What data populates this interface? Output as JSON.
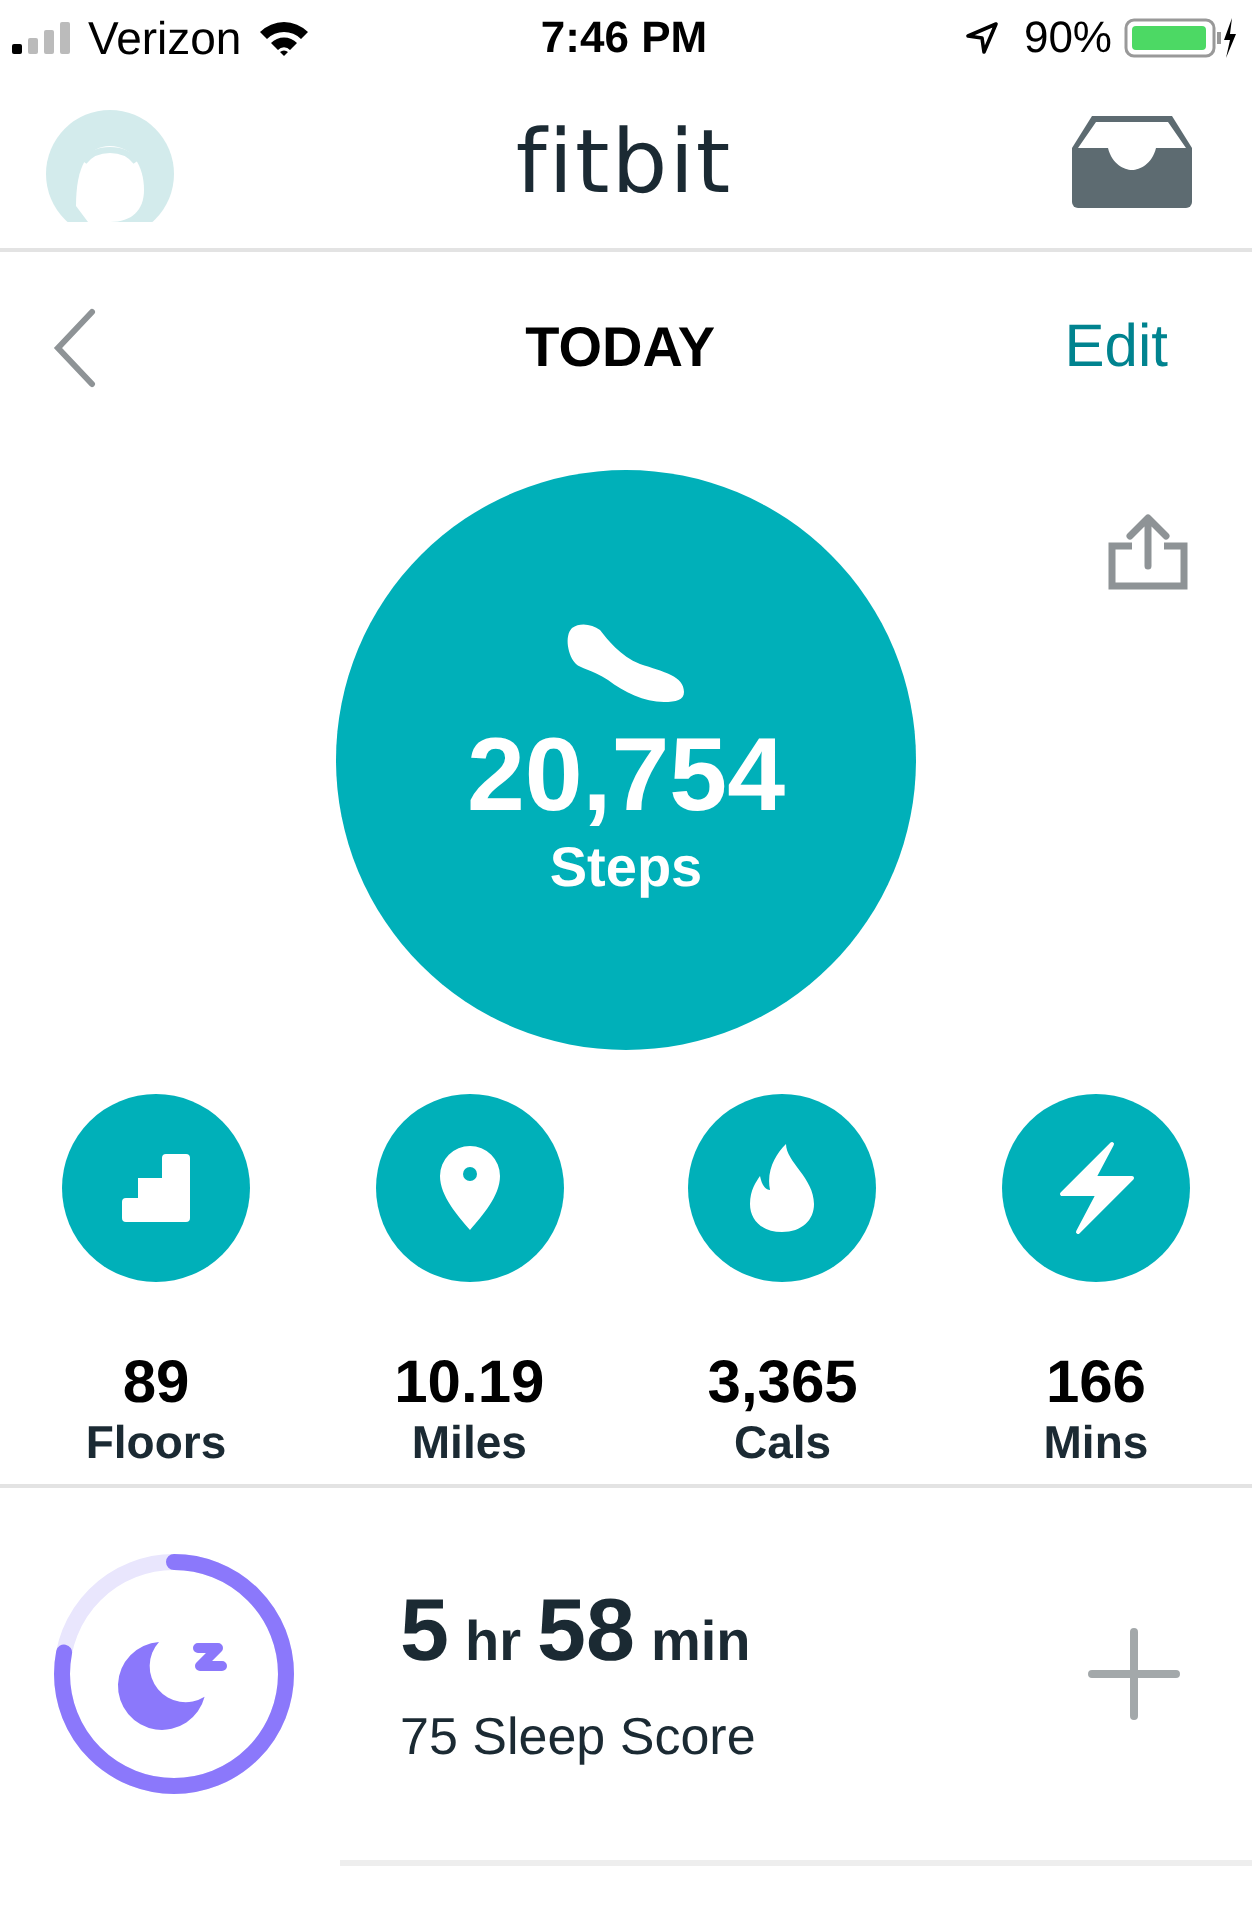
{
  "status_bar": {
    "carrier": "Verizon",
    "time": "7:46 PM",
    "battery": "90%"
  },
  "header": {
    "logo": "fitbit"
  },
  "nav": {
    "title": "TODAY",
    "edit": "Edit"
  },
  "steps": {
    "value": "20,754",
    "label": "Steps"
  },
  "stats": [
    {
      "kind": "floors",
      "value": "89",
      "label": "Floors"
    },
    {
      "kind": "distance",
      "value": "10.19",
      "label": "Miles"
    },
    {
      "kind": "calories",
      "value": "3,365",
      "label": "Cals"
    },
    {
      "kind": "active",
      "value": "166",
      "label": "Mins"
    }
  ],
  "sleep": {
    "hours": "5",
    "hours_unit": "hr",
    "minutes": "58",
    "minutes_unit": "min",
    "score": "75 Sleep Score",
    "level": 0.78
  }
}
